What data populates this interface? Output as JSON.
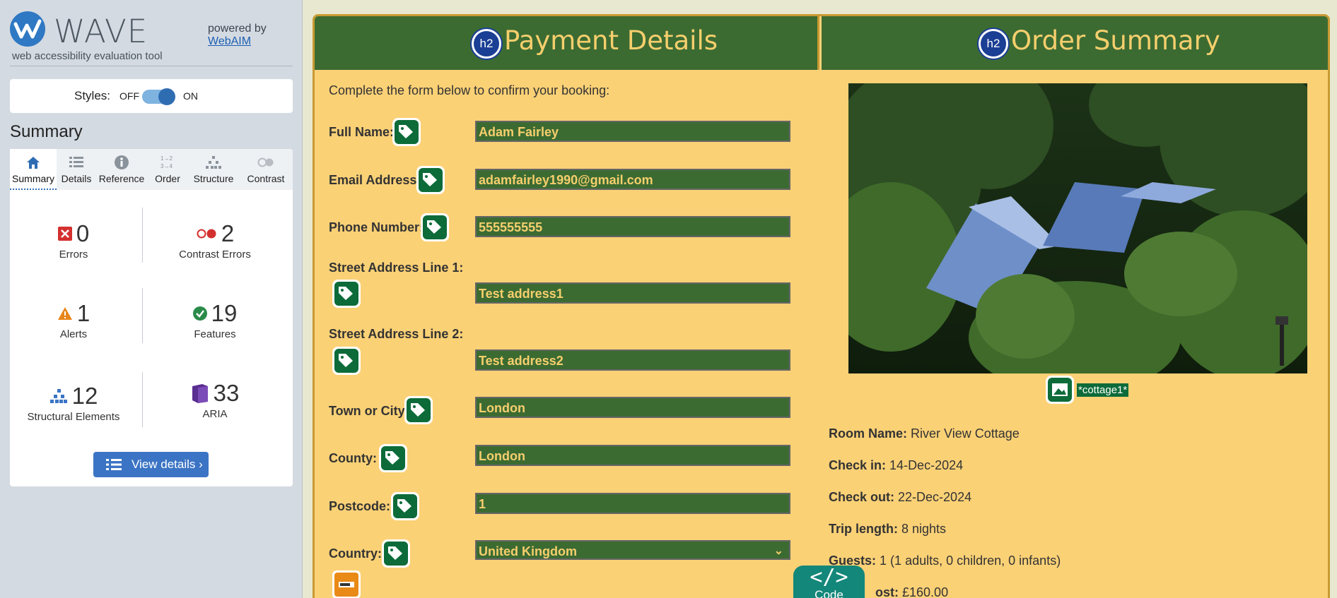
{
  "wave": {
    "name": "WAVE",
    "tagline": "web accessibility evaluation tool",
    "powered_by": "powered by",
    "powered_link": "WebAIM",
    "styles_label": "Styles:",
    "styles_off": "OFF",
    "styles_on": "ON",
    "summary_title": "Summary",
    "tabs": [
      {
        "label": "Summary",
        "icon": "home-icon",
        "active": true
      },
      {
        "label": "Details",
        "icon": "list-icon"
      },
      {
        "label": "Reference",
        "icon": "info-icon"
      },
      {
        "label": "Order",
        "icon": "order-icon"
      },
      {
        "label": "Structure",
        "icon": "structure-icon"
      },
      {
        "label": "Contrast",
        "icon": "contrast-icon"
      }
    ],
    "stats": {
      "errors": {
        "count": "0",
        "label": "Errors"
      },
      "contrast": {
        "count": "2",
        "label": "Contrast Errors"
      },
      "alerts": {
        "count": "1",
        "label": "Alerts"
      },
      "features": {
        "count": "19",
        "label": "Features"
      },
      "structural": {
        "count": "12",
        "label": "Structural Elements"
      },
      "aria": {
        "count": "33",
        "label": "ARIA"
      }
    },
    "view_details": "View details ›",
    "colors": {
      "accent": "#3b74c4",
      "error": "#d3302f",
      "alert": "#e8861b",
      "feature": "#2a8a4a",
      "aria": "#5a2d91"
    }
  },
  "page": {
    "payment_title": "Payment Details",
    "summary_title": "Order Summary",
    "h2_badge": "h2",
    "intro": "Complete the form below to confirm your booking:",
    "fields": {
      "full_name": {
        "label": "Full Name:",
        "value": "Adam Fairley"
      },
      "email": {
        "label": "Email Address:",
        "value": "adamfairley1990@gmail.com"
      },
      "phone": {
        "label": "Phone Number:",
        "value": "555555555"
      },
      "street1": {
        "label": "Street Address Line 1:",
        "value": "Test address1"
      },
      "street2": {
        "label": "Street Address Line 2:",
        "value": "Test address2"
      },
      "town": {
        "label": "Town or City:",
        "value": "London"
      },
      "county": {
        "label": "County:",
        "value": "London"
      },
      "postcode": {
        "label": "Postcode:",
        "value": "1"
      },
      "country": {
        "label": "Country:",
        "value": "United Kingdom"
      }
    },
    "image_alt": "*cottage1*",
    "order": {
      "room_label": "Room Name:",
      "room": "River View Cottage",
      "checkin_label": "Check in:",
      "checkin": "14-Dec-2024",
      "checkout_label": "Check out:",
      "checkout": "22-Dec-2024",
      "trip_label": "Trip length:",
      "trip": "8 nights",
      "guests_label": "Guests:",
      "guests": "1 (1 adults, 0 children, 0 infants)",
      "cost_label": "ost:",
      "cost": "£160.00"
    },
    "code_glyph": "</>",
    "code_label": "Code",
    "colors": {
      "header": "#3c6b32",
      "background": "#fbd176",
      "gold": "#f6cf6d"
    }
  }
}
